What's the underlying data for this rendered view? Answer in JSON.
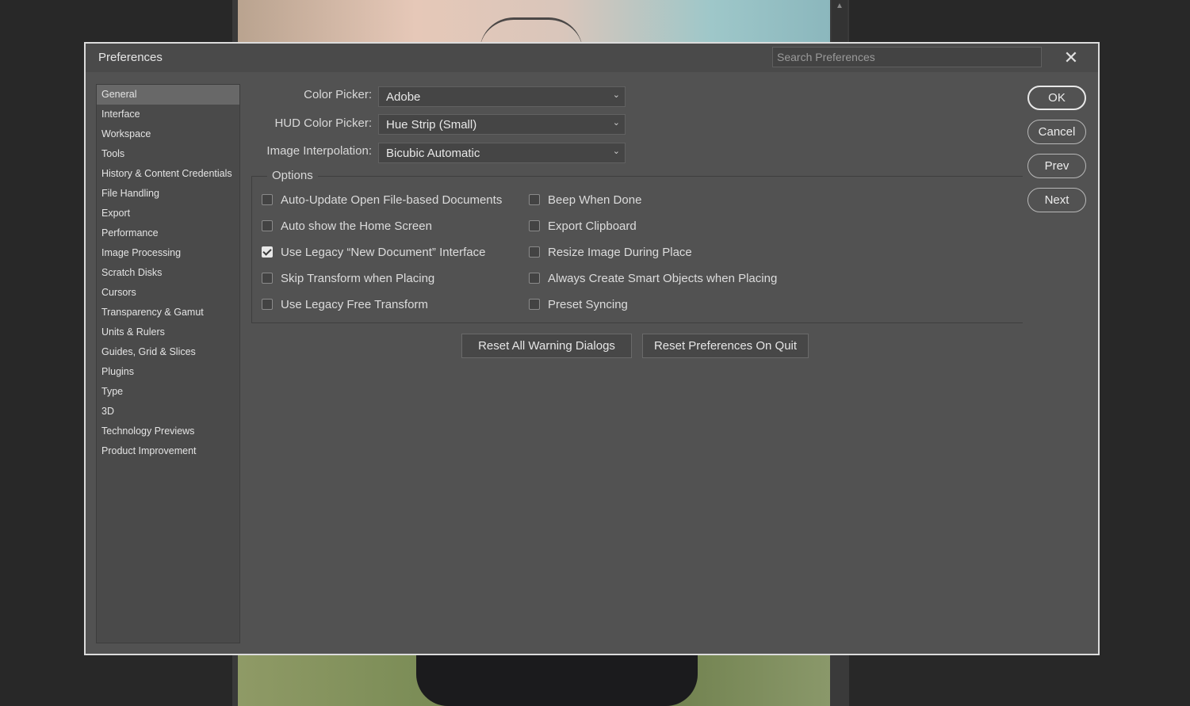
{
  "dialog": {
    "title": "Preferences",
    "search_placeholder": "Search Preferences",
    "close_symbol": "✕"
  },
  "sidebar": {
    "items": [
      "General",
      "Interface",
      "Workspace",
      "Tools",
      "History & Content Credentials",
      "File Handling",
      "Export",
      "Performance",
      "Image Processing",
      "Scratch Disks",
      "Cursors",
      "Transparency & Gamut",
      "Units & Rulers",
      "Guides, Grid & Slices",
      "Plugins",
      "Type",
      "3D",
      "Technology Previews",
      "Product Improvement"
    ],
    "active_index": 0
  },
  "general": {
    "color_picker": {
      "label": "Color Picker:",
      "value": "Adobe"
    },
    "hud_color_picker": {
      "label": "HUD Color Picker:",
      "value": "Hue Strip (Small)"
    },
    "image_interpolation": {
      "label": "Image Interpolation:",
      "value": "Bicubic Automatic"
    }
  },
  "options": {
    "title": "Options",
    "left": [
      {
        "label": "Auto-Update Open File-based Documents",
        "checked": false
      },
      {
        "label": "Auto show the Home Screen",
        "checked": false
      },
      {
        "label": "Use Legacy “New Document” Interface",
        "checked": true
      },
      {
        "label": "Skip Transform when Placing",
        "checked": false
      },
      {
        "label": "Use Legacy Free Transform",
        "checked": false
      }
    ],
    "right": [
      {
        "label": "Beep When Done",
        "checked": false
      },
      {
        "label": "Export Clipboard",
        "checked": false
      },
      {
        "label": "Resize Image During Place",
        "checked": false
      },
      {
        "label": "Always Create Smart Objects when Placing",
        "checked": false
      },
      {
        "label": "Preset Syncing",
        "checked": false
      }
    ]
  },
  "actions": {
    "reset_warnings": "Reset All Warning Dialogs",
    "reset_prefs": "Reset Preferences On Quit"
  },
  "buttons": {
    "ok": "OK",
    "cancel": "Cancel",
    "prev": "Prev",
    "next": "Next"
  },
  "icons": {
    "dropdown": "chevron-down-icon",
    "close": "close-icon",
    "checkbox_checked": "checkmark-icon"
  }
}
